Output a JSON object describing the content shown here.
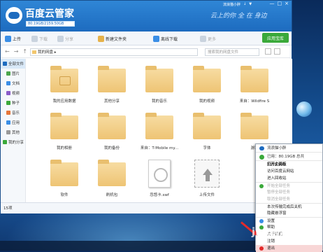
{
  "app": {
    "title": "百度云管家",
    "quota": "80.19GB/2159.50GB",
    "slogan": "云上的你 全 在 身边",
    "user_area": [
      "流浪猫小胖",
      "↓",
      "▼"
    ],
    "window_controls": [
      "—",
      "□",
      "×"
    ],
    "badge": "应用宝库"
  },
  "toolbar": {
    "buttons": [
      {
        "label": "上传",
        "color": "#3a8ee6",
        "disabled": false
      },
      {
        "label": "下载",
        "color": "#c9d3de",
        "disabled": true
      },
      {
        "label": "分享",
        "color": "#c9d3de",
        "disabled": true
      },
      {
        "label": "新建文件夹",
        "color": "#e6b24a",
        "disabled": false
      },
      {
        "label": "离线下载",
        "color": "#3a8ee6",
        "disabled": false
      },
      {
        "label": "更多",
        "color": "#c9d3de",
        "disabled": true
      }
    ]
  },
  "nav": {
    "back": "←",
    "forward": "→",
    "up": "↑",
    "breadcrumb": "我的网盘  ▸",
    "search_placeholder": "搜索我的网盘文件"
  },
  "sidebar": {
    "items": [
      {
        "label": "全部文件",
        "color": "#1d6bbf",
        "sub": false,
        "active": true
      },
      {
        "label": "图片",
        "color": "#4ca64c",
        "sub": true,
        "active": false
      },
      {
        "label": "文档",
        "color": "#3a8ee6",
        "sub": true,
        "active": false
      },
      {
        "label": "视频",
        "color": "#8a5cc9",
        "sub": true,
        "active": false
      },
      {
        "label": "种子",
        "color": "#3aa93a",
        "sub": true,
        "active": false
      },
      {
        "label": "音乐",
        "color": "#e6763a",
        "sub": true,
        "active": false
      },
      {
        "label": "应用",
        "color": "#3a8ee6",
        "sub": true,
        "active": false
      },
      {
        "label": "其他",
        "color": "#999999",
        "sub": true,
        "active": false
      },
      {
        "label": "我的分享",
        "color": "#3aa93a",
        "sub": false,
        "active": false
      }
    ]
  },
  "files": [
    {
      "name": "我的应用数据",
      "type": "folder-app"
    },
    {
      "name": "其他分享",
      "type": "folder"
    },
    {
      "name": "我的音乐",
      "type": "folder"
    },
    {
      "name": "我的视频",
      "type": "folder"
    },
    {
      "name": "来自：Wildfire S",
      "type": "folder"
    },
    {
      "name": "我的相册",
      "type": "folder"
    },
    {
      "name": "我的备份",
      "type": "folder"
    },
    {
      "name": "来自：T-Mobile my...",
      "type": "folder"
    },
    {
      "name": "字体",
      "type": "folder"
    },
    {
      "name": "游戏",
      "type": "folder"
    },
    {
      "name": "软件",
      "type": "folder"
    },
    {
      "name": "刷机包",
      "type": "folder"
    },
    {
      "name": "忽悠卡.swf",
      "type": "video"
    },
    {
      "name": "上传文件",
      "type": "upload"
    }
  ],
  "status": "15项",
  "context_menu": {
    "header": "流浪猫小胖",
    "quota": "已用：80.19GB   总共2159.50G",
    "items": [
      {
        "label": "打开主面板",
        "bold": true,
        "dis": false,
        "sep": false,
        "hl": false,
        "icon": ""
      },
      {
        "label": "访问百度云网站",
        "bold": false,
        "dis": false,
        "sep": false,
        "hl": false,
        "icon": ""
      },
      {
        "label": "进入回收站",
        "bold": false,
        "dis": false,
        "sep": false,
        "hl": false,
        "icon": ""
      },
      {
        "label": "开始全部任务",
        "bold": false,
        "dis": true,
        "sep": true,
        "hl": false,
        "icon": "#3aa93a"
      },
      {
        "label": "暂停全部任务",
        "bold": false,
        "dis": true,
        "sep": false,
        "hl": false,
        "icon": ""
      },
      {
        "label": "取消全部任务",
        "bold": false,
        "dis": true,
        "sep": false,
        "hl": false,
        "icon": ""
      },
      {
        "label": "本次传输完成后关机",
        "bold": false,
        "dis": false,
        "sep": true,
        "hl": false,
        "icon": ""
      },
      {
        "label": "隐藏悬浮窗",
        "bold": false,
        "dis": false,
        "sep": false,
        "hl": false,
        "icon": ""
      },
      {
        "label": "设置",
        "bold": false,
        "dis": false,
        "sep": true,
        "hl": false,
        "icon": "#3a8ee6"
      },
      {
        "label": "帮助",
        "bold": false,
        "dis": false,
        "sep": false,
        "hl": false,
        "icon": "#3aa93a"
      },
      {
        "label": "关于我们",
        "bold": false,
        "dis": false,
        "sep": false,
        "hl": false,
        "icon": ""
      },
      {
        "label": "注销",
        "bold": false,
        "dis": false,
        "sep": false,
        "hl": false,
        "icon": ""
      },
      {
        "label": "退出",
        "bold": false,
        "dis": false,
        "sep": false,
        "hl": true,
        "icon": "#e32a2a"
      }
    ]
  },
  "watermark": "jingyan"
}
